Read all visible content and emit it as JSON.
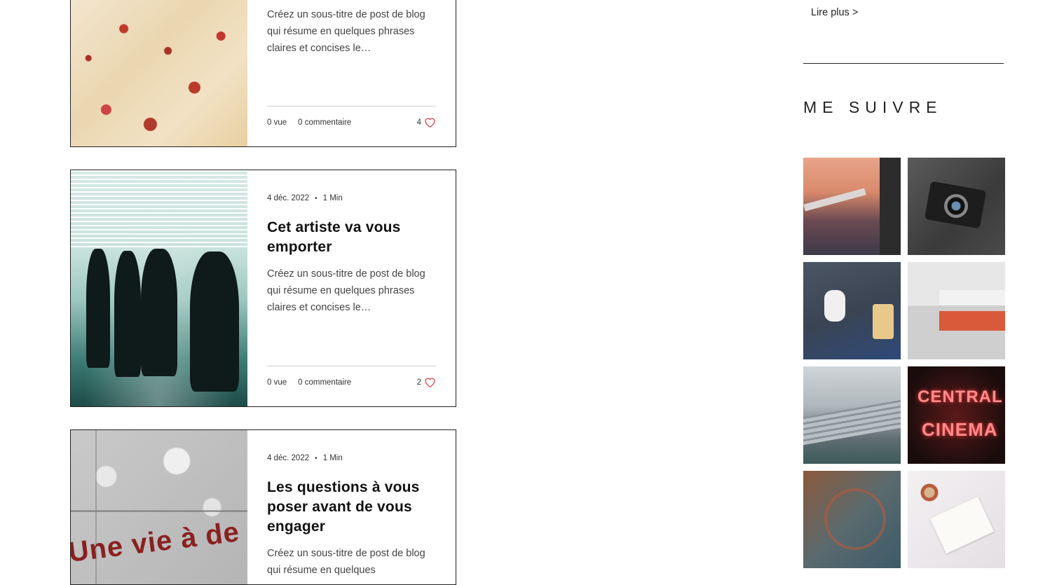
{
  "posts": [
    {
      "date": "",
      "read_time": "",
      "title": "",
      "excerpt": "Créez un sous-titre de post de blog qui résume en quelques phrases claires et concises le…",
      "views": "0 vue",
      "comments": "0 commentaire",
      "likes": "4"
    },
    {
      "date": "4 déc. 2022",
      "read_time": "1 Min",
      "title": "Cet artiste va vous emporter",
      "excerpt": "Créez un sous-titre de post de blog qui résume en quelques phrases claires et concises le…",
      "views": "0 vue",
      "comments": "0 commentaire",
      "likes": "2"
    },
    {
      "date": "4 déc. 2022",
      "read_time": "1 Min",
      "title": "Les questions à vous poser avant de vous engager",
      "excerpt": "Créez un sous-titre de post de blog qui résume en quelques",
      "image_text": "Une vie à de"
    }
  ],
  "sidebar": {
    "read_more": "Lire plus >",
    "follow_heading": "ME SUIVRE",
    "gallery": [
      {
        "name": "airplane-wing-sunset"
      },
      {
        "name": "vintage-camera"
      },
      {
        "name": "feet-sneakers-food"
      },
      {
        "name": "books-on-shelf"
      },
      {
        "name": "stairs-building"
      },
      {
        "name": "central-cinema-neon"
      },
      {
        "name": "feet-on-tiles"
      },
      {
        "name": "book-and-coffee"
      }
    ]
  },
  "colors": {
    "heart": "#e0404a",
    "border": "#222222",
    "rule": "#cfcfcf"
  }
}
